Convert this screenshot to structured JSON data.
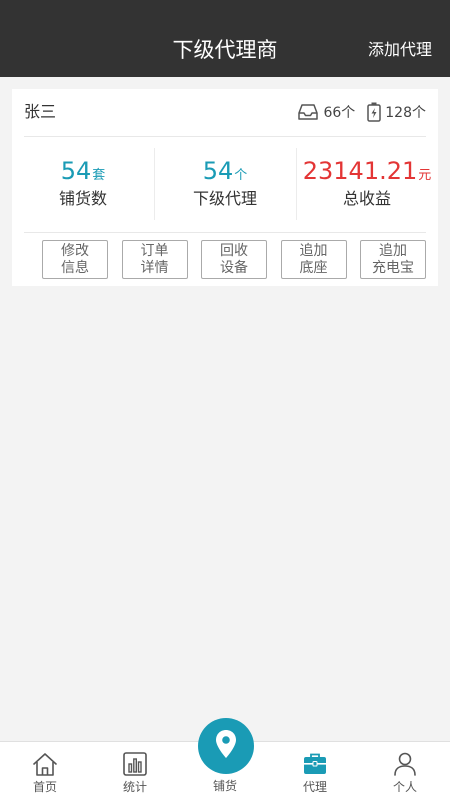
{
  "header": {
    "title": "下级代理商",
    "action_label": "添加代理"
  },
  "agent": {
    "name": "张三",
    "inbox_count": "66个",
    "battery_count": "128个",
    "stats": [
      {
        "value": "54",
        "unit": "套",
        "label": "铺货数"
      },
      {
        "value": "54",
        "unit": "个",
        "label": "下级代理"
      },
      {
        "value": "23141.21",
        "unit": "元",
        "label": "总收益"
      }
    ],
    "actions": [
      {
        "line1": "修改",
        "line2": "信息"
      },
      {
        "line1": "订单",
        "line2": "详情"
      },
      {
        "line1": "回收",
        "line2": "设备"
      },
      {
        "line1": "追加",
        "line2": "底座"
      },
      {
        "line1": "追加",
        "line2": "充电宝"
      }
    ]
  },
  "tabbar": {
    "items": [
      {
        "label": "首页",
        "icon": "home-icon"
      },
      {
        "label": "统计",
        "icon": "bar-chart-icon"
      },
      {
        "label": "铺货",
        "icon": "location-pin-icon"
      },
      {
        "label": "代理",
        "icon": "briefcase-icon"
      },
      {
        "label": "个人",
        "icon": "person-icon"
      }
    ],
    "active_index": 3
  },
  "colors": {
    "header_bg": "#333333",
    "accent": "#1a9bb5",
    "earnings": "#e33535"
  }
}
